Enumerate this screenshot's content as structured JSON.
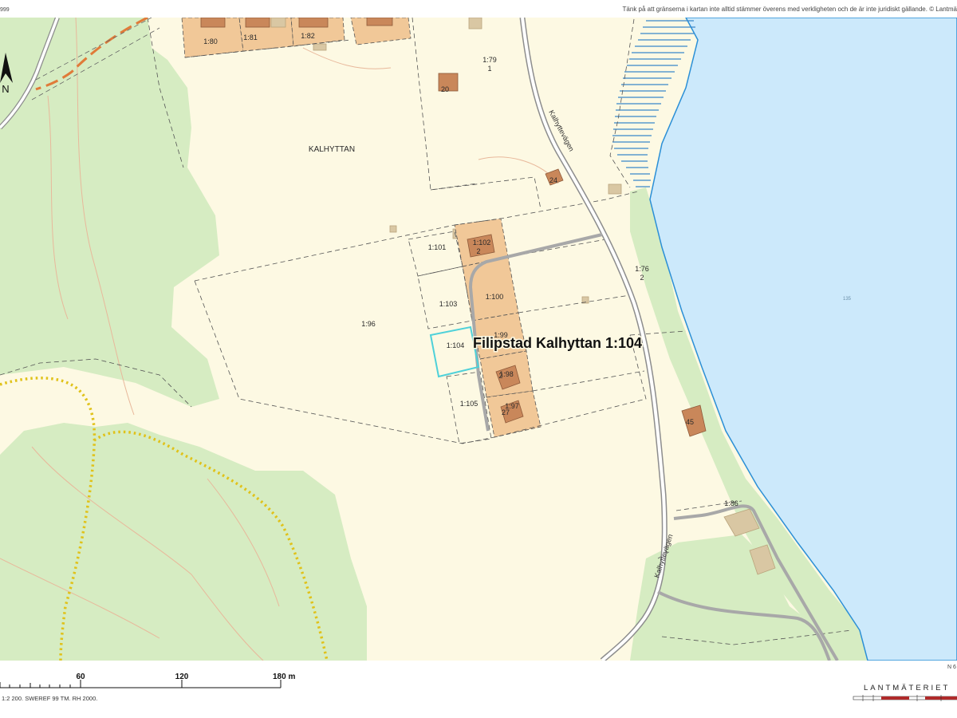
{
  "header": {
    "left_fragment": "999",
    "disclaimer": "Tänk på att gränserna i kartan inte alltid stämmer överens med verkligheten och de är inte juridiskt gällande. © Lantmä"
  },
  "compass": {
    "label": "N"
  },
  "title": "Filipstad Kalhyttan 1:104",
  "place_name": "KALHYTTAN",
  "road_name": "Kalhyttevägen",
  "lake_label": "135",
  "parcels": [
    "1:80",
    "1:81",
    "1:82",
    "1:79",
    "1:101",
    "1:102",
    "1:103",
    "1:100",
    "1:99",
    "1:104",
    "1:98",
    "1:105",
    "1:97",
    "1:96",
    "1:76",
    "1:86"
  ],
  "addresses": [
    "1",
    "20",
    "24",
    "2",
    "2",
    "2",
    "27",
    "45"
  ],
  "scale_bar": {
    "labels": [
      "60",
      "120",
      "180 m"
    ],
    "info": "1:2 200. SWEREF 99 TM. RH 2000."
  },
  "corner_fragment": "N 6",
  "brand": "LANTMÄTERIET",
  "colors": {
    "land": "#fdf9e3",
    "forest": "#d6ecc2",
    "water": "#cce9fb",
    "shore": "#2b8fd6",
    "building": "#c9875a",
    "owned_parcel": "#f1c898",
    "road": "#a8a8a8",
    "highlight": "#4fd1d9",
    "path": "#e0c21a",
    "contour": "#e8b89b"
  }
}
